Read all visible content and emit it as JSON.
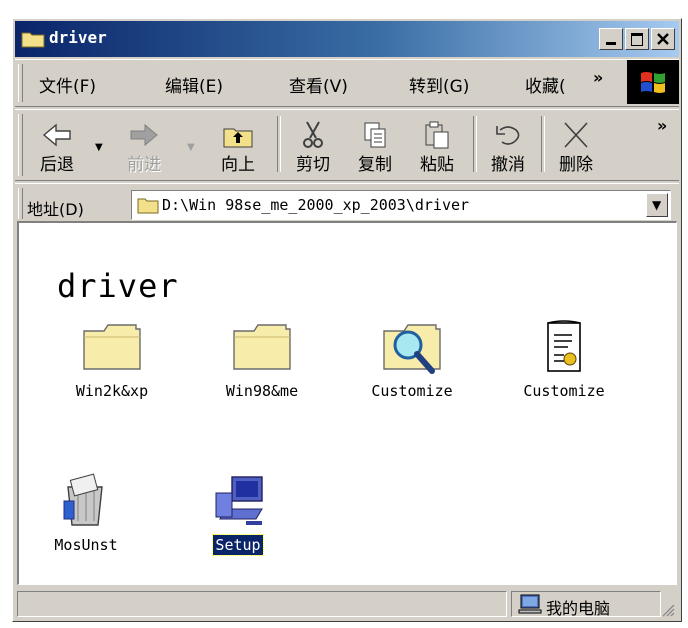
{
  "window": {
    "title": "driver"
  },
  "menu": {
    "items": [
      "文件(F)",
      "编辑(E)",
      "查看(V)",
      "转到(G)",
      "收藏("
    ],
    "chevron": "»"
  },
  "toolbar": {
    "back": "后退",
    "forward": "前进",
    "up": "向上",
    "cut": "剪切",
    "copy": "复制",
    "paste": "粘贴",
    "undo": "撤消",
    "delete": "删除",
    "chevron": "»"
  },
  "address": {
    "label": "地址(D)",
    "value": "D:\\Win 98se_me_2000_xp_2003\\driver"
  },
  "content": {
    "title": "driver",
    "items": [
      {
        "name": "Win2k&xp",
        "icon": "folder-icon"
      },
      {
        "name": "Win98&me",
        "icon": "folder-icon"
      },
      {
        "name": "Customize",
        "icon": "folder-search-icon"
      },
      {
        "name": "Customize",
        "icon": "config-file-icon"
      },
      {
        "name": "MosUnst",
        "icon": "uninstall-icon"
      },
      {
        "name": "Setup",
        "icon": "setup-computer-icon",
        "selected": true
      }
    ]
  },
  "status": {
    "computer": "我的电脑"
  },
  "colors": {
    "titlebar": "#0a246a",
    "face": "#d4d0c8",
    "selection": "#0a246a"
  }
}
